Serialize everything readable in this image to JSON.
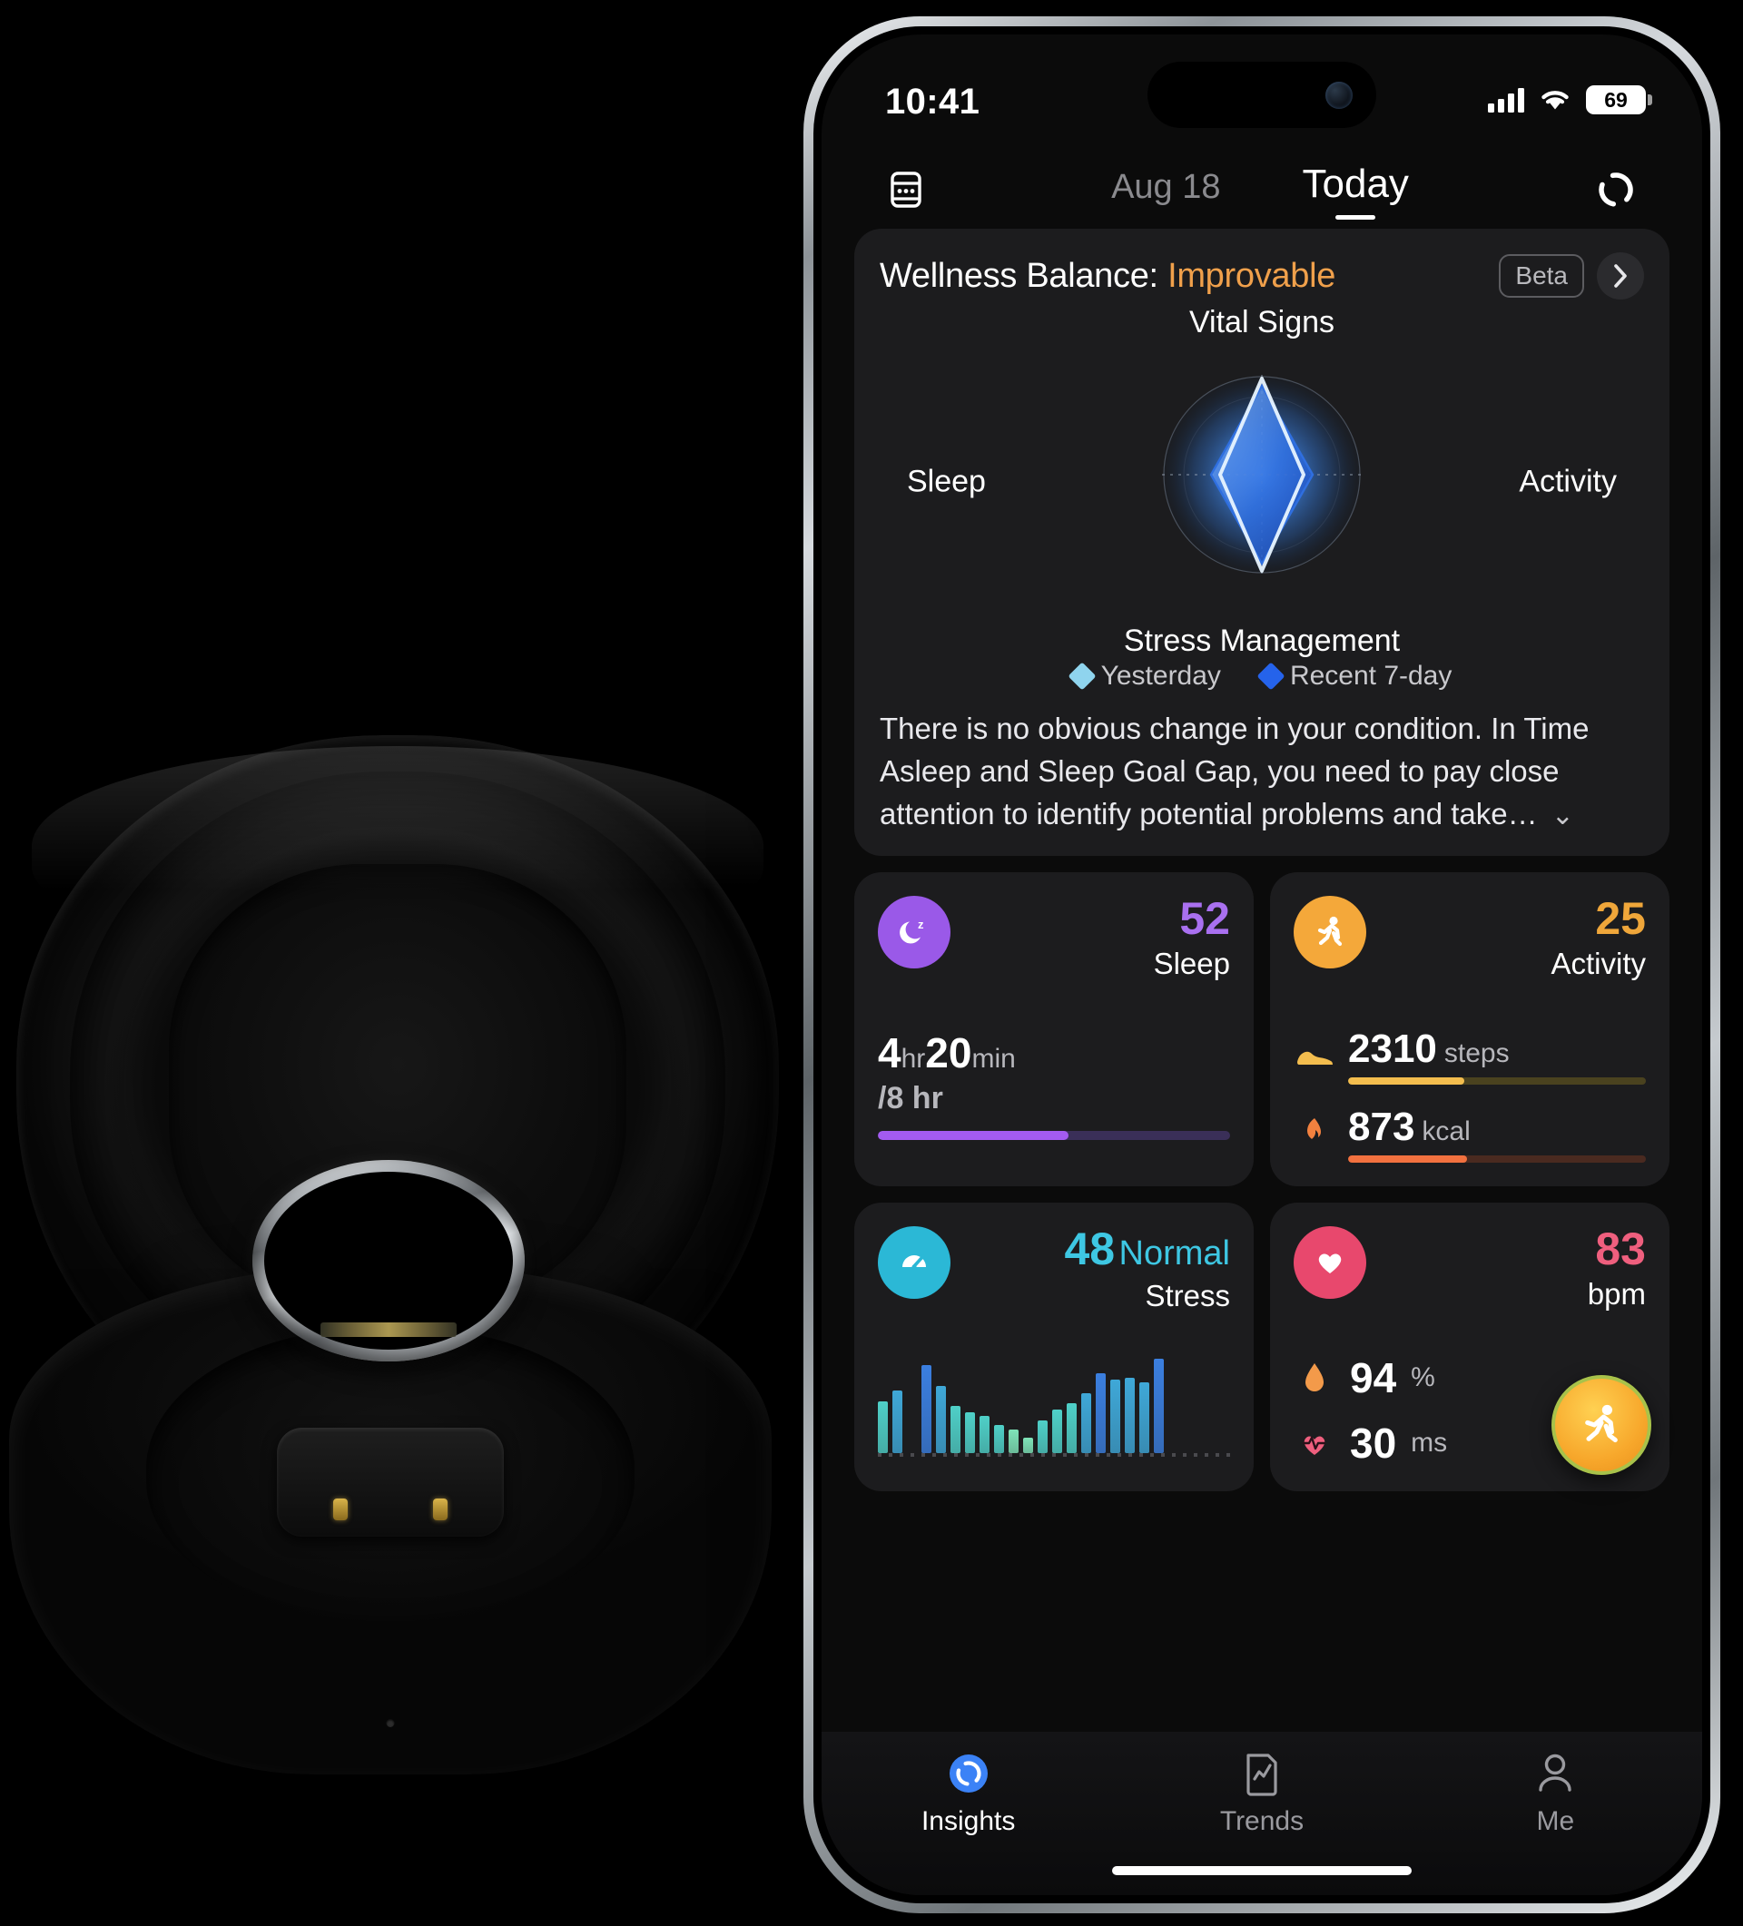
{
  "status_bar": {
    "time": "10:41",
    "battery_level": "69",
    "cellular_icon": "cellular-signal-icon",
    "wifi_icon": "wifi-icon"
  },
  "top_nav": {
    "calendar_icon": "calendar-icon",
    "sync_icon": "ring-sync-icon",
    "dates": [
      {
        "label": "Aug 18",
        "active": false
      },
      {
        "label": "Today",
        "active": true
      }
    ]
  },
  "wellness": {
    "title_prefix": "Wellness Balance: ",
    "status": "Improvable",
    "status_color": "#f0a04b",
    "beta_badge": "Beta",
    "chevron_icon": "chevron-right-icon",
    "axes": {
      "top": "Vital Signs",
      "right": "Activity",
      "bottom": "Stress Management",
      "left": "Sleep"
    },
    "legend": [
      {
        "label": "Yesterday",
        "color": "#8fd4ee"
      },
      {
        "label": "Recent 7-day",
        "color": "#2563eb"
      }
    ],
    "summary": "There is no obvious change in your condition. In Time Asleep and Sleep Goal Gap, you need to pay close attention to identify potential problems and take…",
    "expand_icon": "chevron-down-icon"
  },
  "chart_data": {
    "type": "radar",
    "title": "Wellness Balance",
    "categories": [
      "Vital Signs",
      "Activity",
      "Stress Management",
      "Sleep"
    ],
    "series": [
      {
        "name": "Yesterday",
        "color": "#bfe6f5",
        "values": [
          96,
          33,
          95,
          31
        ]
      },
      {
        "name": "Recent 7-day",
        "color": "#2563eb",
        "values": [
          88,
          29,
          86,
          27
        ]
      }
    ],
    "range": [
      0,
      100
    ],
    "grid": true,
    "legend_position": "bottom"
  },
  "tiles": {
    "sleep": {
      "icon": "moon-sleep-icon",
      "icon_bg": "#9a59e8",
      "score": "52",
      "score_color": "#a970f0",
      "label": "Sleep",
      "duration_hours": "4",
      "hours_unit": "hr",
      "duration_minutes": "20",
      "minutes_unit": "min",
      "goal": "/8 hr",
      "progress_percent": 54,
      "bar_color": "#a35bf0",
      "bar_track": "#3a2f58"
    },
    "activity": {
      "icon": "running-person-icon",
      "icon_bg": "#f4a83a",
      "score": "25",
      "score_color": "#efa63a",
      "label": "Activity",
      "metrics": [
        {
          "icon": "sneaker-icon",
          "value": "2310",
          "unit": "steps",
          "progress_percent": 39,
          "fill_color": "#f3bd4e",
          "track_color": "#4a421f"
        },
        {
          "icon": "flame-icon",
          "value": "873",
          "unit": "kcal",
          "progress_percent": 40,
          "fill_color": "#f2713f",
          "track_color": "#4a2a20"
        }
      ]
    },
    "stress": {
      "icon": "gauge-icon",
      "icon_bg": "#2bb8d6",
      "score": "48",
      "score_color": "#3ec7e3",
      "status": "Normal",
      "label": "Stress",
      "chart": {
        "type": "bar",
        "values": [
          48,
          58,
          0,
          82,
          62,
          44,
          38,
          34,
          26,
          22,
          14,
          30,
          40,
          46,
          56,
          74,
          68,
          70,
          66,
          88
        ],
        "ylim": [
          0,
          100
        ]
      }
    },
    "heart": {
      "icon": "heart-icon",
      "icon_bg": "#e8486d",
      "score": "83",
      "score_color": "#ef5f7e",
      "label": "bpm",
      "metrics": [
        {
          "icon": "blood-drop-icon",
          "value": "94",
          "unit": "%"
        },
        {
          "icon": "heart-pulse-icon",
          "value": "30",
          "unit": "ms"
        }
      ],
      "fab_icon": "running-person-icon"
    }
  },
  "tab_bar": {
    "items": [
      {
        "label": "Insights",
        "icon": "insights-ring-icon",
        "active": true
      },
      {
        "label": "Trends",
        "icon": "trends-chart-icon",
        "active": false
      },
      {
        "label": "Me",
        "icon": "person-icon",
        "active": false
      }
    ]
  }
}
